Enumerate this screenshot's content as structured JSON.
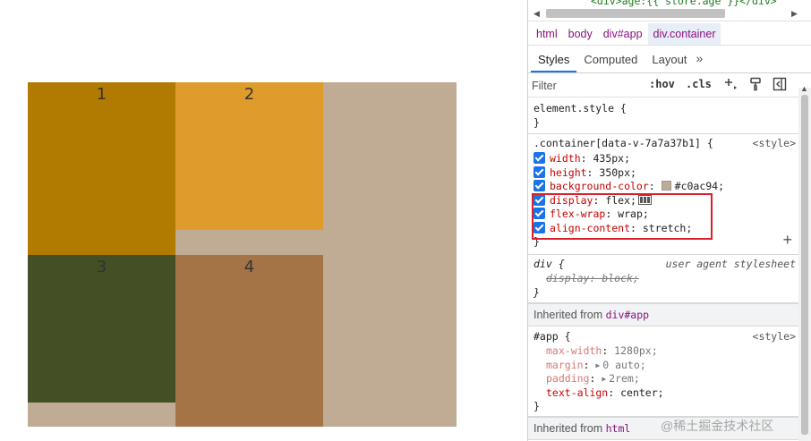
{
  "page": {
    "container_color": "#c0ac94",
    "boxes": [
      {
        "label": "1",
        "color": "#b17a00"
      },
      {
        "label": "2",
        "color": "#e09b2d"
      },
      {
        "label": "3",
        "color": "#444f26"
      },
      {
        "label": "4",
        "color": "#a47446"
      }
    ]
  },
  "devtools": {
    "source_line": "<div>age:{{ store.age }}</div>",
    "breadcrumbs": [
      "html",
      "body",
      "div#app",
      "div.container"
    ],
    "tabs": [
      "Styles",
      "Computed",
      "Layout"
    ],
    "tabs_more_icon": "chevrons-right-icon",
    "filter_placeholder": "Filter",
    "tools": {
      "hov": ":hov",
      "cls": ".cls"
    },
    "rules": {
      "element_style": {
        "selector": "element.style {",
        "close": "}"
      },
      "container": {
        "selector": ".container[data-v-7a7a37b1] {",
        "origin": "<style>",
        "declarations": [
          {
            "prop": "width",
            "value": "435px;"
          },
          {
            "prop": "height",
            "value": "350px;"
          },
          {
            "prop": "background-color",
            "value": "#c0ac94;",
            "swatch": "#c0ac94"
          },
          {
            "prop": "display",
            "value": "flex;"
          },
          {
            "prop": "flex-wrap",
            "value": "wrap;"
          },
          {
            "prop": "align-content",
            "value": "stretch;"
          }
        ],
        "close": "}"
      },
      "ua_div": {
        "selector": "div {",
        "origin": "user agent stylesheet",
        "declaration": "display: block;",
        "close": "}"
      },
      "inherited_app": {
        "label": "Inherited from ",
        "source": "div#app"
      },
      "app": {
        "selector": "#app {",
        "origin": "<style>",
        "declarations": [
          {
            "prop": "max-width",
            "value": "1280px;"
          },
          {
            "prop": "margin",
            "value": "0 auto;"
          },
          {
            "prop": "padding",
            "value": "2rem;"
          },
          {
            "prop": "text-align",
            "value": "center;"
          }
        ],
        "close": "}"
      },
      "inherited_html": {
        "label": "Inherited from ",
        "source": "html"
      }
    }
  },
  "watermark": "@稀土掘金技术社区",
  "colors": {
    "accent": "#1a73e8",
    "highlight_border": "#d9202a",
    "tag": "#881280",
    "property": "#c80000"
  }
}
